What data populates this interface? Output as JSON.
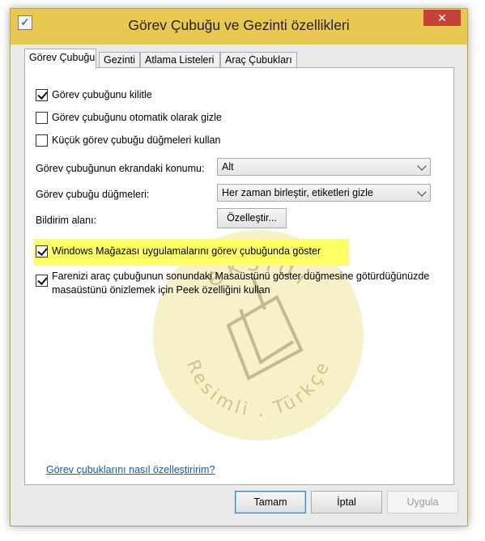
{
  "window": {
    "title": "Görev Çubuğu ve Gezinti özellikleri",
    "close_label": "✕",
    "icon_glyph": "✓"
  },
  "tabs": [
    {
      "label": "Görev Çubuğu"
    },
    {
      "label": "Gezinti"
    },
    {
      "label": "Atlama Listeleri"
    },
    {
      "label": "Araç Çubukları"
    }
  ],
  "options": {
    "lock_taskbar": {
      "label": "Görev çubuğunu kilitle",
      "checked": true
    },
    "auto_hide": {
      "label": "Görev çubuğunu otomatik olarak gizle",
      "checked": false
    },
    "small_buttons": {
      "label": "Küçük görev çubuğu düğmeleri kullan",
      "checked": false
    },
    "store_apps": {
      "label": "Windows Mağazası uygulamalarını görev çubuğunda göster",
      "checked": true
    },
    "peek": {
      "label": "Farenizi araç çubuğunun sonundaki Masaüstünü göster düğmesine götürdüğünüzde masaüstünü önizlemek için Peek özelliğini kullan",
      "checked": true
    }
  },
  "location": {
    "label": "Görev çubuğunun ekrandaki konumu:",
    "value": "Alt"
  },
  "buttons_combine": {
    "label": "Görev çubuğu düğmeleri:",
    "value": "Her zaman birleştir, etiketleri gizle"
  },
  "notification": {
    "label": "Bildirim alanı:",
    "button": "Özelleştir..."
  },
  "help_link": "Görev çubuklarını nasıl özelleştiririm?",
  "footer": {
    "ok": "Tamam",
    "cancel": "İptal",
    "apply": "Uygula"
  },
  "watermark": {
    "top_text": "eksidi",
    "bottom_text": "Resimli . Türkçe"
  },
  "colors": {
    "title_bar": "#e8c850",
    "close": "#c7403a",
    "highlight": "#ffff66",
    "link": "#0b5fb5"
  }
}
